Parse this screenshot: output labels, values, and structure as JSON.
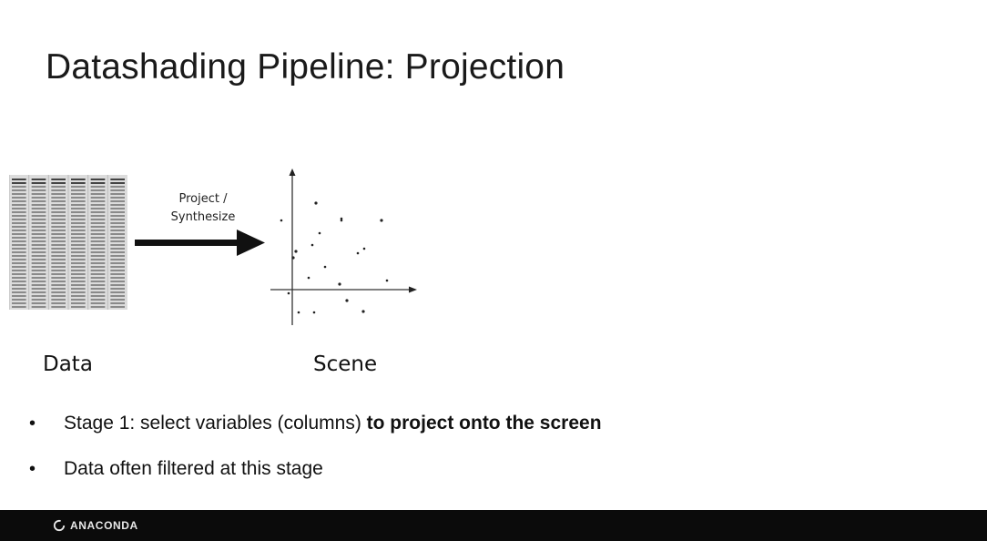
{
  "slide": {
    "title": "Datashading Pipeline: Projection",
    "arrow_label_line1": "Project /",
    "arrow_label_line2": "Synthesize",
    "caption_data": "Data",
    "caption_scene": "Scene",
    "bullets": [
      {
        "plain": "Stage 1: select variables (columns) ",
        "bold": "to project onto the screen"
      },
      {
        "plain": "Data often filtered at this stage",
        "bold": ""
      }
    ],
    "bullet_glyph": "•"
  },
  "footer": {
    "brand": "ANACONDA",
    "background": "#0b0b0b",
    "logo_icon": "anaconda-ring-icon"
  },
  "icons": {
    "data_table": "data-table-icon",
    "arrow": "right-arrow-icon",
    "scene": "scatter-plot-icon"
  }
}
